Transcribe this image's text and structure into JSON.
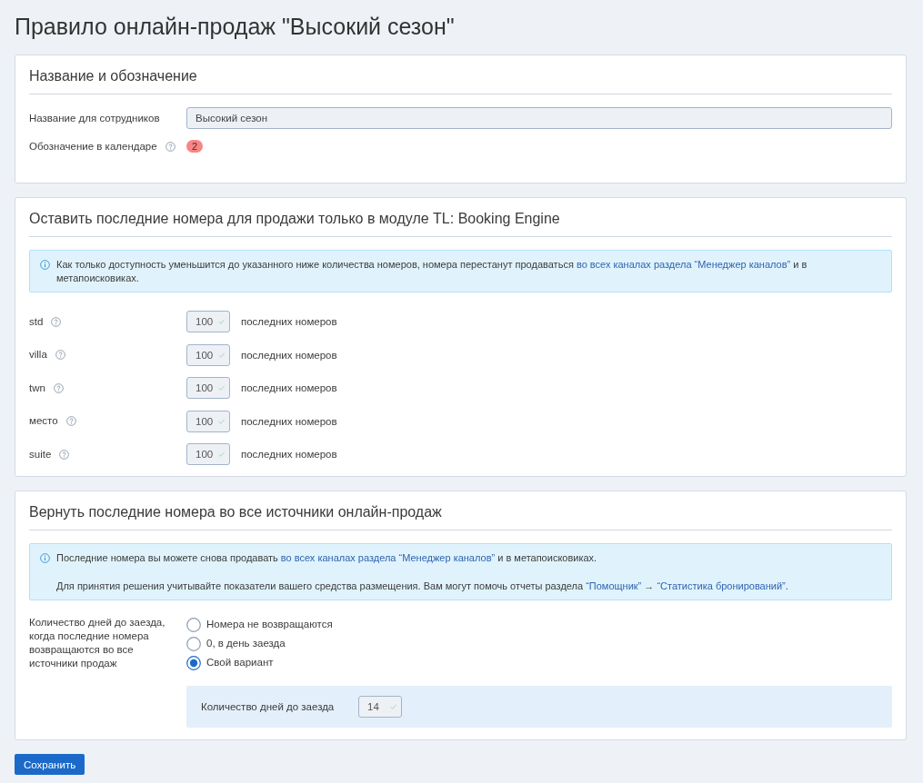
{
  "page_title": "Правило онлайн-продаж \"Высокий сезон\"",
  "name_section": {
    "title": "Название и обозначение",
    "fields": [
      {
        "kind": "text",
        "label": "Название для сотрудников",
        "help": false,
        "value": "Высокий сезон"
      },
      {
        "kind": "badge",
        "label": "Обозначение в календаре",
        "help": true,
        "badge": "2",
        "color": "#f98585"
      }
    ]
  },
  "booking_engine_section": {
    "title": "Оставить последние номера для продажи только в модуле TL: Booking Engine",
    "info": [
      [
        {
          "text": "Как только доступность уменьшится до указанного ниже количества номеров, номера перестанут продаваться ",
          "link": false
        },
        {
          "text": "во всех каналах раздела “Менеджер каналов”",
          "link": true
        },
        {
          "text": " и в метапоисковиках.",
          "link": false
        }
      ]
    ],
    "rooms": [
      {
        "label": "std",
        "help": true,
        "value": "100",
        "valid": true,
        "suffix": "последних номеров"
      },
      {
        "label": "villa",
        "help": true,
        "value": "100",
        "valid": true,
        "suffix": "последних номеров"
      },
      {
        "label": "twn",
        "help": true,
        "value": "100",
        "valid": true,
        "suffix": "последних номеров"
      },
      {
        "label": "место",
        "help": true,
        "value": "100",
        "valid": true,
        "suffix": "последних номеров"
      },
      {
        "label": "suite",
        "help": true,
        "value": "100",
        "valid": true,
        "suffix": "последних номеров"
      }
    ]
  },
  "return_section": {
    "title": "Вернуть последние номера во все источники онлайн-продаж",
    "info": [
      [
        {
          "text": "Последние номера вы можете снова продавать ",
          "link": false
        },
        {
          "text": "во всех каналах раздела “Менеджер каналов”",
          "link": true
        },
        {
          "text": " и в метапоисковиках.",
          "link": false
        }
      ],
      [
        {
          "text": "Для принятия решения учитывайте показатели вашего средства размещения. Вам могут помочь отчеты раздела ",
          "link": false
        },
        {
          "text": "“Помощник”",
          "link": true
        },
        {
          "text": " → ",
          "link": false
        },
        {
          "text": "“Статистика бронирований”",
          "link": true
        },
        {
          "text": ".",
          "link": false
        }
      ]
    ],
    "question": "Количество дней до заезда, когда последние номера возвращаются во все источники продаж",
    "options": [
      {
        "label": "Номера не возвращаются",
        "selected": false
      },
      {
        "label": "0, в день заезда",
        "selected": false
      },
      {
        "label": "Свой вариант",
        "selected": true
      }
    ],
    "custom": {
      "label": "Количество дней до заезда",
      "value": "14",
      "valid": true
    }
  },
  "save_button": "Сохранить"
}
